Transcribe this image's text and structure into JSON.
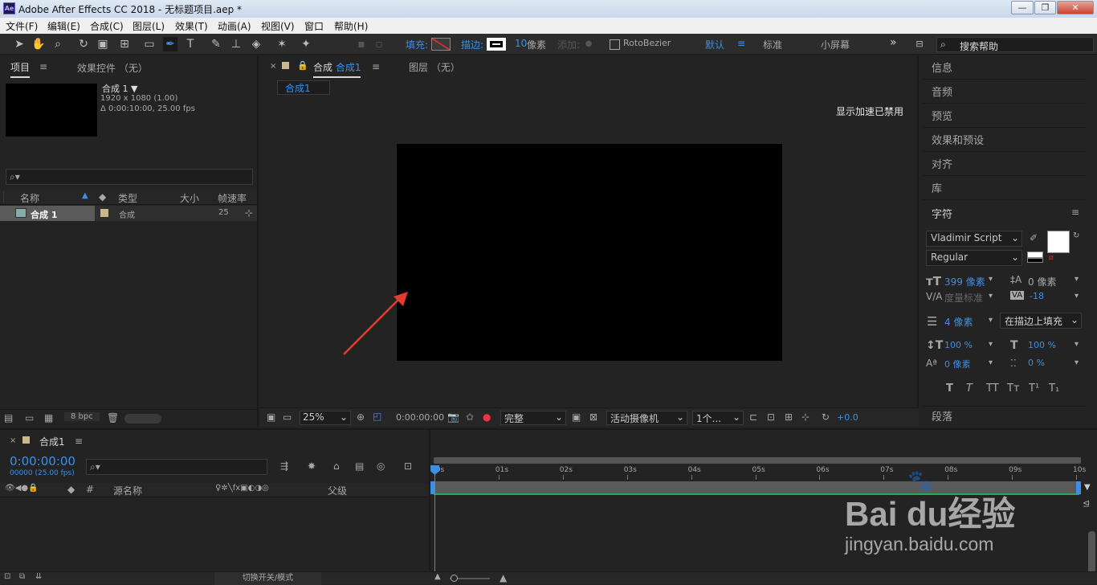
{
  "titlebar": {
    "app_icon": "Ae",
    "title": "Adobe After Effects CC 2018 - 无标题项目.aep *",
    "minimize": "—",
    "maximize": "❐",
    "close": "✕"
  },
  "menu": [
    "文件(F)",
    "编辑(E)",
    "合成(C)",
    "图层(L)",
    "效果(T)",
    "动画(A)",
    "视图(V)",
    "窗口",
    "帮助(H)"
  ],
  "toolbar": {
    "fill_label": "填充:",
    "stroke_label": "描边:",
    "stroke_width": "10",
    "stroke_unit": "像素",
    "add_label": "添加:",
    "rotobezier": "RotoBezier",
    "workspaces": [
      "默认",
      "标准",
      "小屏幕"
    ],
    "more": "»",
    "search_placeholder": "搜索帮助"
  },
  "project_panel": {
    "tab_project": "项目",
    "tab_effects": "效果控件 （无）",
    "comp_name": "合成 1 ▼",
    "comp_res": "1920 x 1080 (1.00)",
    "comp_duration": "Δ 0:00:10:00, 25.00 fps",
    "columns": [
      "名称",
      "类型",
      "大小",
      "帧速率"
    ],
    "rows": [
      {
        "name": "合成 1",
        "type": "合成",
        "size": "",
        "fps": "25"
      }
    ],
    "bpc": "8 bpc"
  },
  "comp_panel": {
    "tab_comp_prefix": "合成",
    "tab_comp_name": "合成1",
    "tab_layer": "图层 （无）",
    "breadcrumb": "合成1",
    "accel_notice": "显示加速已禁用",
    "zoom": "25%",
    "timecode": "0:00:00:00",
    "resolution": "完整",
    "camera": "活动摄像机",
    "views": "1个...",
    "exposure": "+0.0"
  },
  "right_panel": {
    "items": [
      "信息",
      "音频",
      "预览",
      "效果和预设",
      "对齐",
      "库"
    ],
    "character_title": "字符",
    "font_family": "Vladimir Script",
    "font_style": "Regular",
    "font_size": "399 像素",
    "leading": "0 像素",
    "kerning": "度量标准",
    "tracking": "-18",
    "stroke_width": "4 像素",
    "stroke_mode": "在描边上填充",
    "vscale": "100 %",
    "hscale": "100 %",
    "baseline": "0 像素",
    "tsume": "0 %",
    "styles": [
      "T",
      "T",
      "TT",
      "Tт",
      "T¹",
      "T₁"
    ],
    "paragraph_title": "段落"
  },
  "timeline": {
    "tab_name": "合成1",
    "timecode": "0:00:00:00",
    "fps_sub": "00000 (25.00 fps)",
    "col_source": "源名称",
    "col_parent": "父级",
    "col_num": "#",
    "ticks": [
      "00s",
      "01s",
      "02s",
      "03s",
      "04s",
      "05s",
      "06s",
      "07s",
      "08s",
      "09s",
      "10s"
    ],
    "bottom_label": "切换开关/模式"
  },
  "colors": {
    "accent": "#3d8fe6",
    "bg": "#232323",
    "green": "#2fa84a"
  }
}
